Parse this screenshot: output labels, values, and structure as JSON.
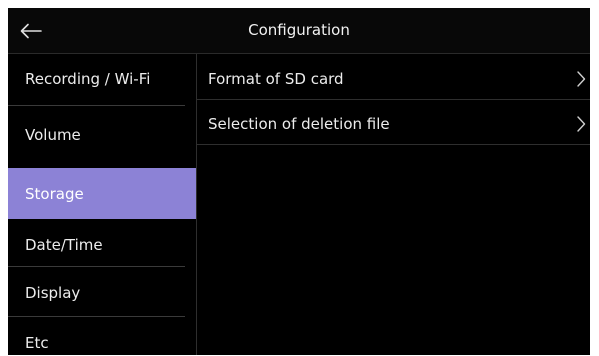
{
  "header": {
    "title": "Configuration",
    "back_icon": "arrow-left-icon"
  },
  "sidebar": {
    "items": [
      {
        "label": "Recording / Wi-Fi",
        "active": false
      },
      {
        "label": "Volume",
        "active": false
      },
      {
        "label": "Storage",
        "active": true
      },
      {
        "label": "Date/Time",
        "active": false
      },
      {
        "label": "Display",
        "active": false
      },
      {
        "label": "Etc",
        "active": false
      }
    ]
  },
  "content": {
    "items": [
      {
        "label": "Format of SD card",
        "icon": "chevron-right-icon"
      },
      {
        "label": "Selection of deletion file",
        "icon": "chevron-right-icon"
      }
    ]
  },
  "colors": {
    "active_item": "#8c82d6",
    "background": "#000000",
    "text": "#ececec"
  }
}
